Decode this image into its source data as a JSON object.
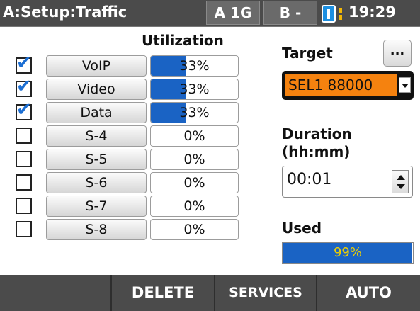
{
  "titlebar": {
    "title": "A:Setup:Traffic",
    "port_a": "A 1G",
    "port_b": "B -",
    "time": "19:29"
  },
  "utilization": {
    "header": "Utilization",
    "rows": [
      {
        "label": "VoIP",
        "pct": "33%",
        "fill": 0.41,
        "checked": true
      },
      {
        "label": "Video",
        "pct": "33%",
        "fill": 0.41,
        "checked": true
      },
      {
        "label": "Data",
        "pct": "33%",
        "fill": 0.41,
        "checked": true
      },
      {
        "label": "S-4",
        "pct": "0%",
        "fill": 0,
        "checked": false
      },
      {
        "label": "S-5",
        "pct": "0%",
        "fill": 0,
        "checked": false
      },
      {
        "label": "S-6",
        "pct": "0%",
        "fill": 0,
        "checked": false
      },
      {
        "label": "S-7",
        "pct": "0%",
        "fill": 0,
        "checked": false
      },
      {
        "label": "S-8",
        "pct": "0%",
        "fill": 0,
        "checked": false
      }
    ]
  },
  "target": {
    "label": "Target",
    "more_label": "...",
    "value": "SEL1 88000"
  },
  "duration": {
    "label_line1": "Duration",
    "label_line2": "(hh:mm)",
    "value": "00:01"
  },
  "used": {
    "label": "Used",
    "value": "99%",
    "fill": 0.99
  },
  "softkeys": [
    "",
    "DELETE",
    "SERVICES",
    "AUTO"
  ],
  "colors": {
    "bar_fill": "#1a63c4",
    "target_bg": "#f5820f",
    "check_mark": "#1b6ed3",
    "chrome": "#4b4b4b"
  }
}
